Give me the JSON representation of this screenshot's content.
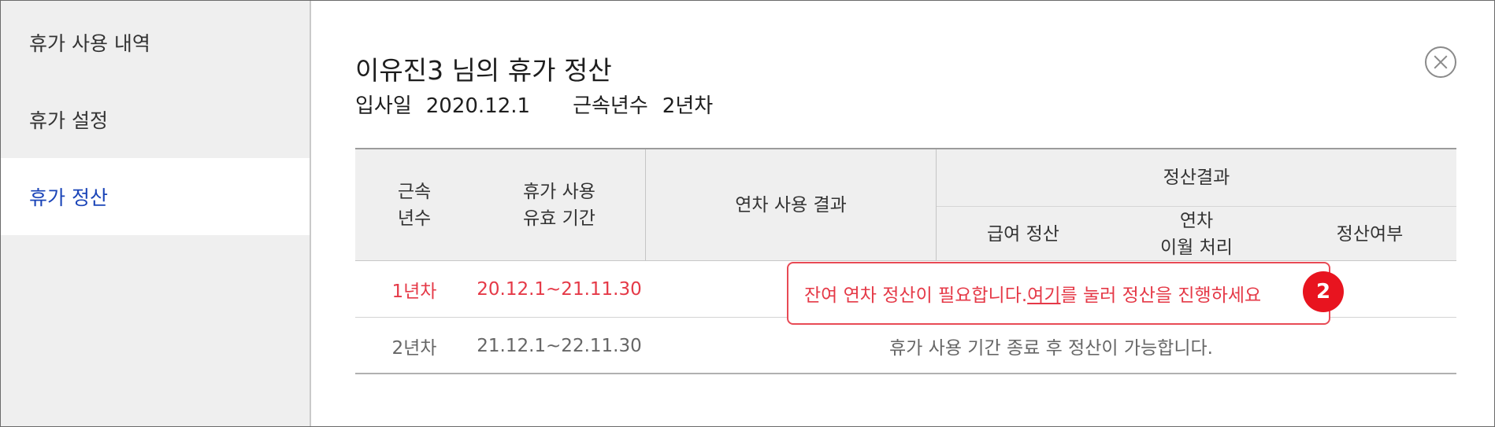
{
  "sidebar": {
    "items": [
      {
        "label": "휴가 사용 내역",
        "active": false
      },
      {
        "label": "휴가 설정",
        "active": false
      },
      {
        "label": "휴가 정산",
        "active": true
      }
    ]
  },
  "header": {
    "title": "이유진3 님의 휴가 정산",
    "join_label": "입사일",
    "join_date": "2020.12.1",
    "tenure_label": "근속년수",
    "tenure_value": "2년차"
  },
  "table": {
    "headers": {
      "tenure": "근속\n년수",
      "period": "휴가 사용\n유효 기간",
      "annual_result": "연차 사용 결과",
      "settlement_result": "정산결과",
      "salary_settlement": "급여 정산",
      "annual_carryover": "연차\n이월 처리",
      "settled": "정산여부"
    },
    "rows": [
      {
        "tenure": "1년차",
        "period": "20.12.1~21.11.30",
        "message": ""
      },
      {
        "tenure": "2년차",
        "period": "21.12.1~22.11.30",
        "message": "휴가 사용 기간 종료 후 정산이 가능합니다."
      }
    ]
  },
  "notice": {
    "text_before": "잔여 연차 정산이 필요합니다. ",
    "link": "여기",
    "text_after": "를 눌러 정산을 진행하세요",
    "badge": "2"
  },
  "colors": {
    "accent_blue": "#1a44b8",
    "alert_red": "#e53947",
    "badge_red": "#e8141f"
  },
  "icons": {
    "close": "close-circle-icon"
  }
}
